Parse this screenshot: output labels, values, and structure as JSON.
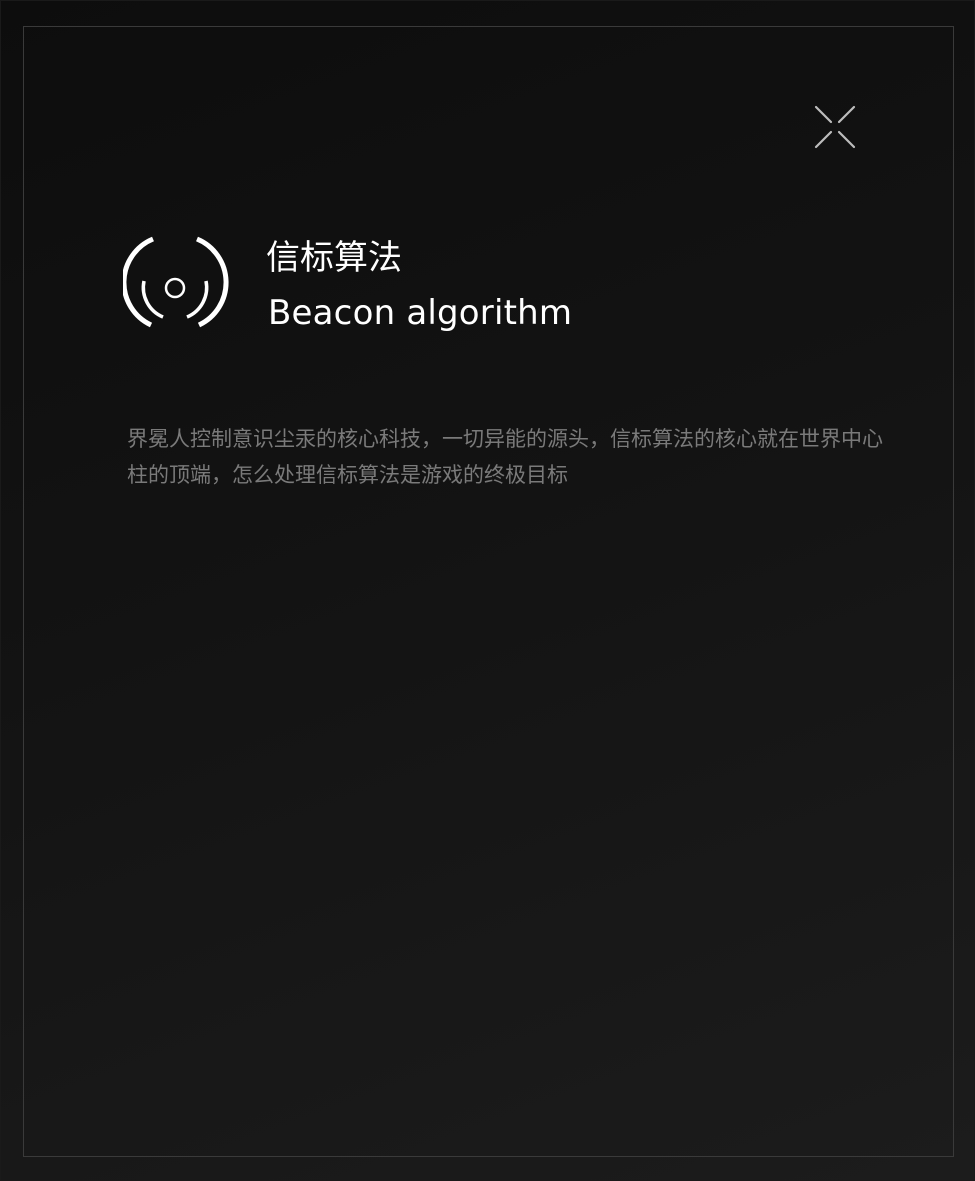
{
  "modal": {
    "close_icon": "collapse-x-icon",
    "logo_icon": "beacon-icon",
    "title_cn": "信标算法",
    "title_en": "Beacon algorithm",
    "description": "界冕人控制意识尘汞的核心科技，一切异能的源头，信标算法的核心就在世界中心柱的顶端，怎么处理信标算法是游戏的终极目标"
  },
  "colors": {
    "background": "#111111",
    "frame_border": "#3a3a3a",
    "title": "#ffffff",
    "description": "#7a7a7a",
    "close_icon": "#bdbdbd"
  }
}
